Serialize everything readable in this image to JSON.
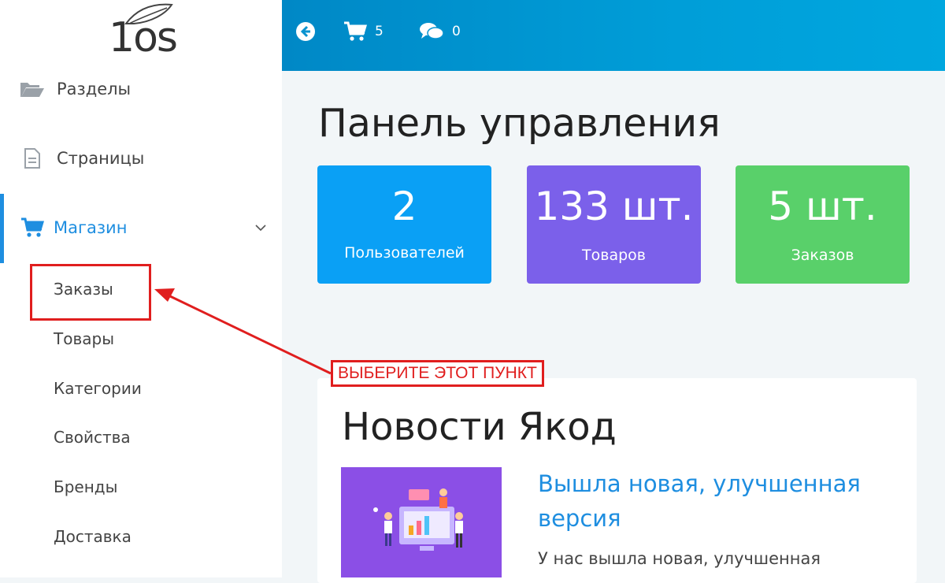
{
  "logo": {
    "text": "1os"
  },
  "sidebar": {
    "items": [
      {
        "label": "Разделы",
        "icon": "folder-open-icon"
      },
      {
        "label": "Страницы",
        "icon": "document-icon"
      },
      {
        "label": "Магазин",
        "icon": "cart-icon",
        "active": true,
        "expanded": true
      }
    ],
    "submenu": [
      "Заказы",
      "Товары",
      "Категории",
      "Свойства",
      "Бренды",
      "Доставка"
    ]
  },
  "topbar": {
    "back_icon": "arrow-circle-left-icon",
    "cart": {
      "icon": "cart-icon",
      "count": "5"
    },
    "comments": {
      "icon": "comments-icon",
      "count": "0"
    }
  },
  "main": {
    "title": "Панель управления",
    "stats": [
      {
        "value": "2",
        "label": "Пользователей",
        "color": "#0aa0f5"
      },
      {
        "value": "133 шт.",
        "label": "Товаров",
        "color": "#7b60ea"
      },
      {
        "value": "5 шт.",
        "label": "Заказов",
        "color": "#59d06a"
      }
    ],
    "news": {
      "heading": "Новости Якод",
      "link": "Вышла новая, улучшенная версия",
      "text": "У нас вышла новая, улучшенная"
    }
  },
  "annotation": {
    "label": "ВЫБЕРИТЕ ЭТОТ ПУНКТ",
    "color": "#e01e1e"
  }
}
